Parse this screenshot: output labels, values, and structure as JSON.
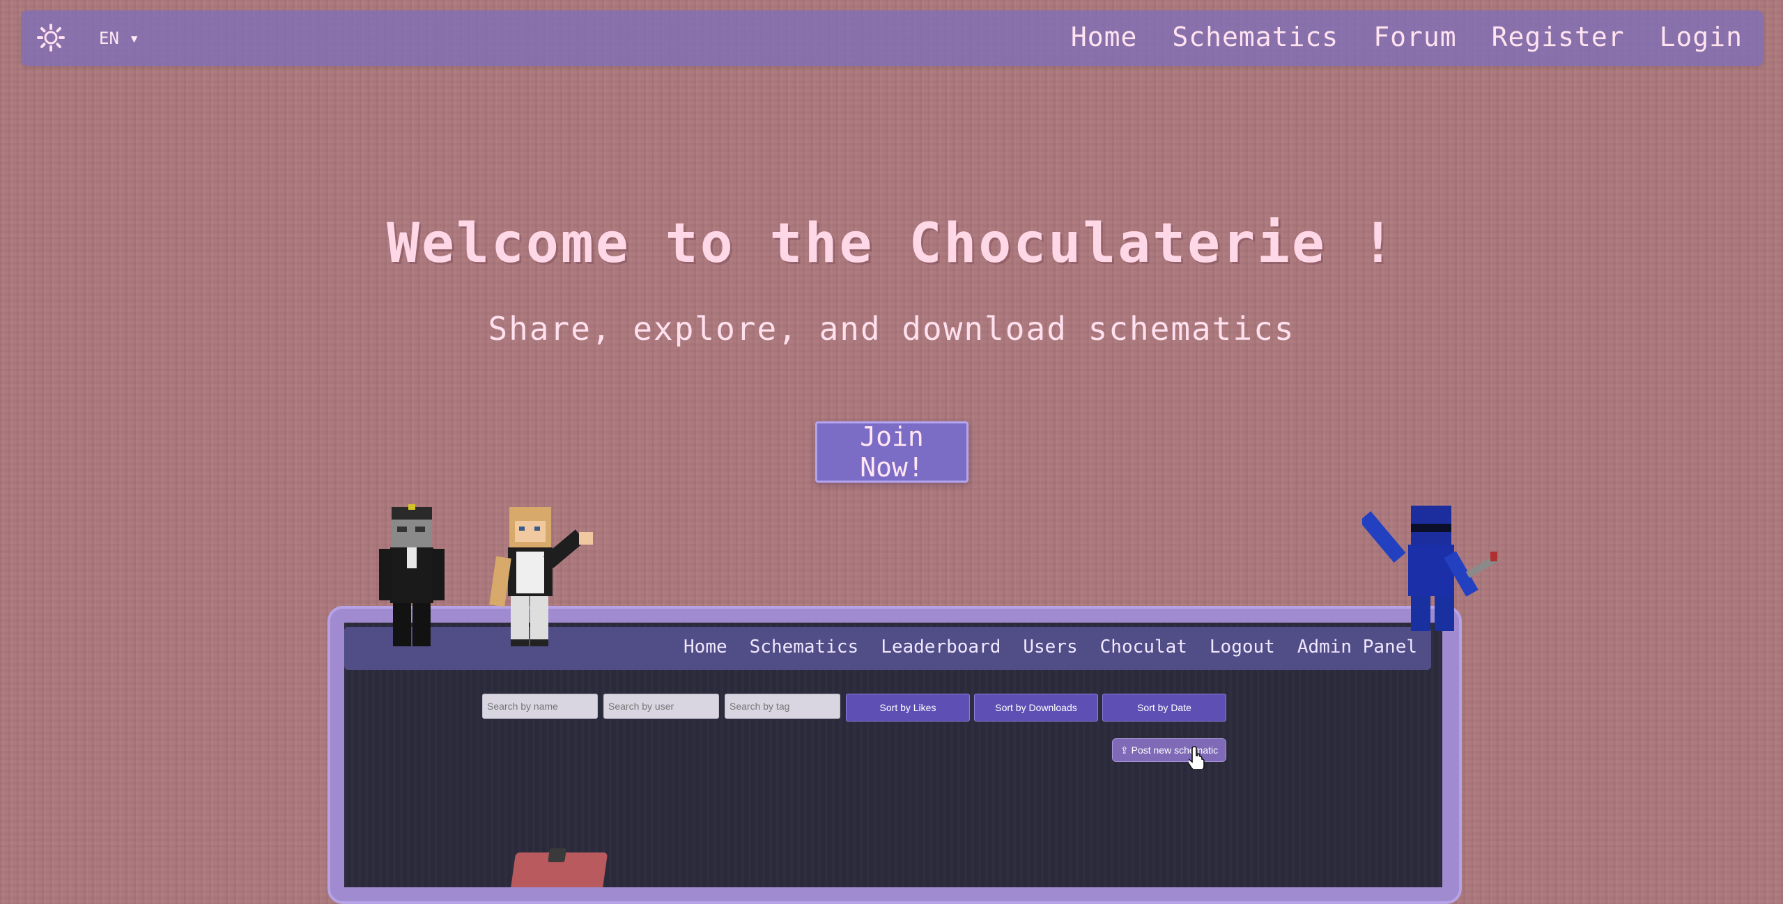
{
  "nav": {
    "language": "EN ▾",
    "links": [
      "Home",
      "Schematics",
      "Forum",
      "Register",
      "Login"
    ]
  },
  "hero": {
    "title": "Welcome to the Choculaterie !",
    "subtitle": "Share, explore, and download schematics",
    "cta": "Join Now!"
  },
  "preview": {
    "nav_links": [
      "Home",
      "Schematics",
      "Leaderboard",
      "Users",
      "Choculat",
      "Logout",
      "Admin Panel"
    ],
    "search": {
      "name_placeholder": "Search by name",
      "user_placeholder": "Search by user",
      "tag_placeholder": "Search by tag"
    },
    "sort_buttons": [
      "Sort by Likes",
      "Sort by Downloads",
      "Sort by Date"
    ],
    "post_button": "Post new schematic"
  },
  "colors": {
    "background": "#ad7a7e",
    "navbar": "#7f6eb8",
    "accent": "#7b6cc6",
    "title_text": "#ffd8e8"
  },
  "icons": {
    "theme_toggle": "sun-icon",
    "post": "upload-icon",
    "cursor": "hand-cursor-icon"
  }
}
